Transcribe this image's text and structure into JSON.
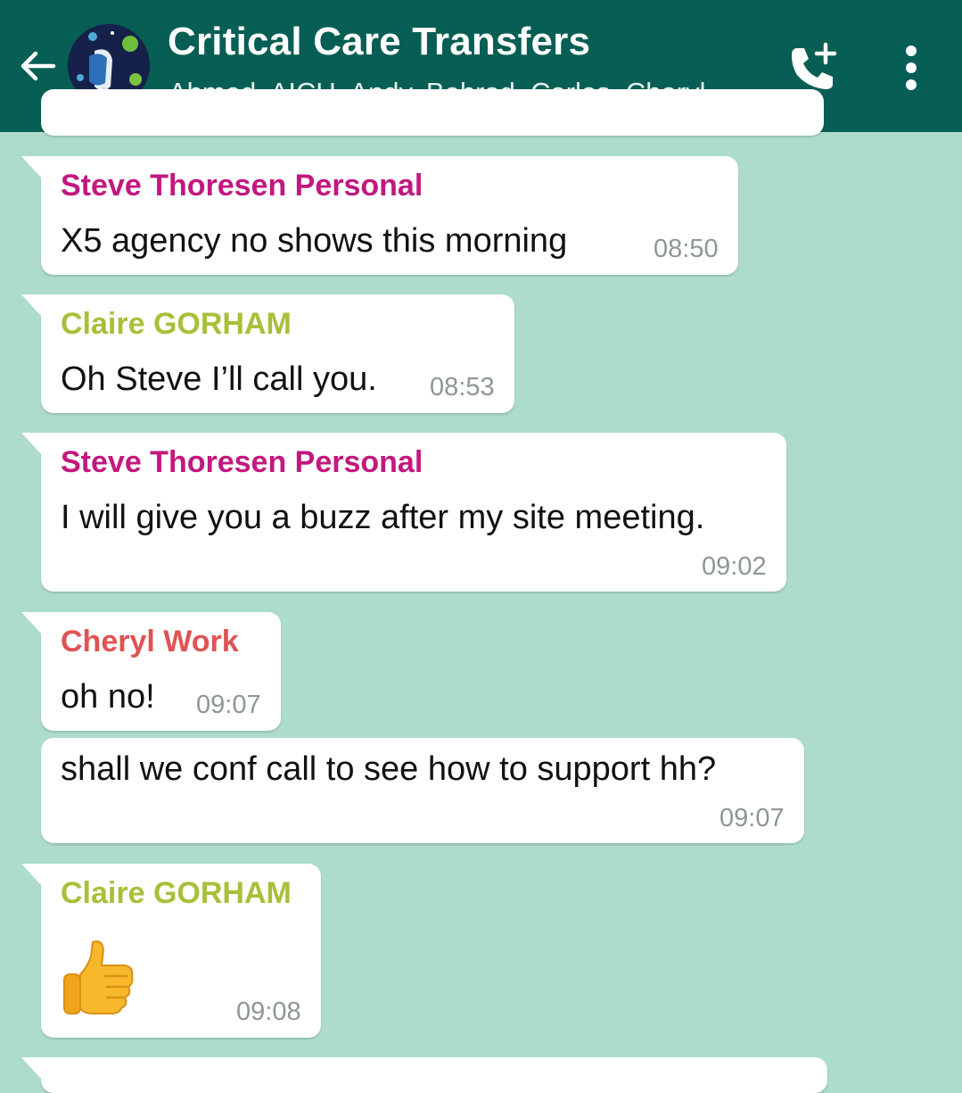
{
  "chat": {
    "title": "Critical Care Transfers",
    "participants": "Ahmed, AICU, Andy, Behrad, Carlos, Cheryl…",
    "avatar_icon": "virus-protection-avatar",
    "actions": {
      "add_call_icon": "add-call-icon",
      "menu_icon": "more-vert-icon"
    }
  },
  "colors": {
    "header": "#075e54",
    "background": "#addccb",
    "sender_steve": "#c2187f",
    "sender_claire": "#a6c03a",
    "sender_cheryl": "#e05353"
  },
  "messages": [
    {
      "sender": "Steve Thoresen Personal",
      "text": "X5 agency no shows this morning",
      "time": "08:50"
    },
    {
      "sender": "Claire GORHAM",
      "text": "Oh Steve I’ll call you.",
      "time": "08:53"
    },
    {
      "sender": "Steve Thoresen Personal",
      "text": "I will give you a buzz after my site meeting.",
      "time": "09:02"
    },
    {
      "sender": "Cheryl Work",
      "text": "oh no!",
      "time": "09:07"
    },
    {
      "sender": "",
      "text": "shall we conf call to see how to support hh?",
      "time": "09:07"
    },
    {
      "sender": "Claire GORHAM",
      "text": "",
      "emoji": "thumbs-up",
      "time": "09:08"
    }
  ]
}
